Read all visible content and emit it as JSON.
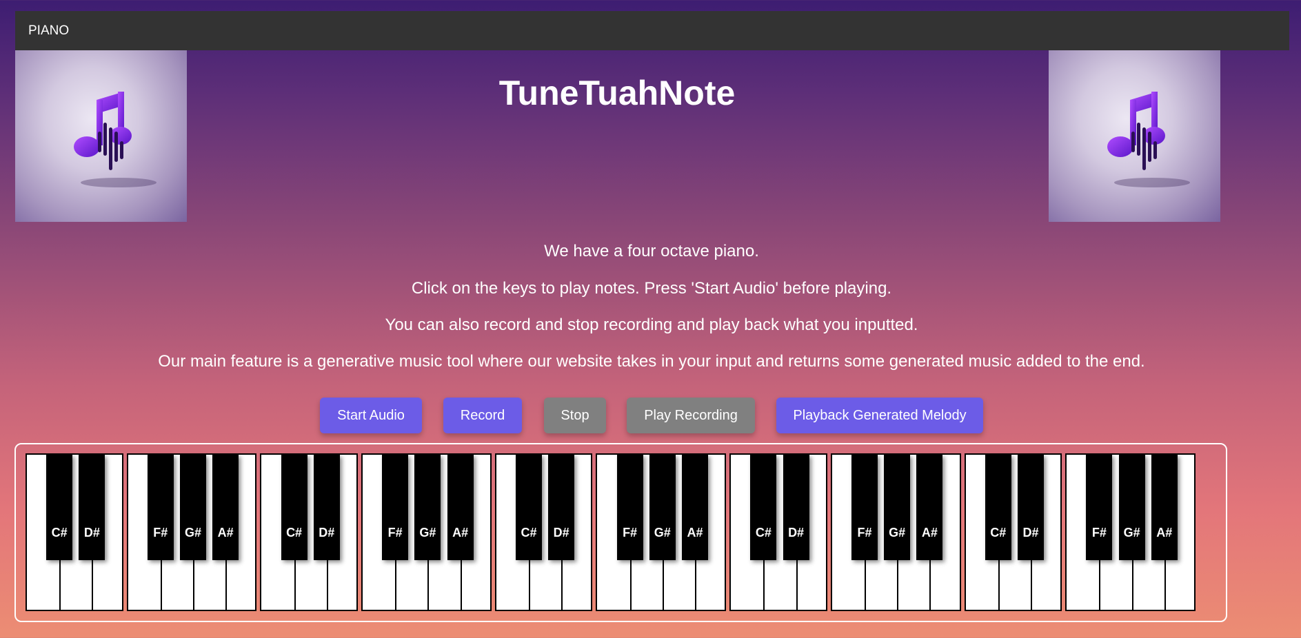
{
  "navbar": {
    "brand": "PIANO"
  },
  "header": {
    "title": "TuneTuahNote",
    "logo_icon": "music-note-icon"
  },
  "description": [
    "We have a four octave piano.",
    "Click on the keys to play notes. Press 'Start Audio' before playing.",
    "You can also record and stop recording and play back what you inputted.",
    "Our main feature is a generative music tool where our website takes in your input and returns some generated music added to the end."
  ],
  "controls": {
    "start_audio": "Start Audio",
    "record": "Record",
    "stop": "Stop",
    "play_recording": "Play Recording",
    "playback_generated": "Playback Generated Melody"
  },
  "colors": {
    "purple_button": "#6c5ce7",
    "gray_button": "#808080",
    "navbar": "#333333"
  },
  "piano": {
    "groups": [
      [
        "C#",
        "D#"
      ],
      [
        "F#",
        "G#",
        "A#"
      ],
      [
        "C#",
        "D#"
      ],
      [
        "F#",
        "G#",
        "A#"
      ],
      [
        "C#",
        "D#"
      ],
      [
        "F#",
        "G#",
        "A#"
      ],
      [
        "C#",
        "D#"
      ],
      [
        "F#",
        "G#",
        "A#"
      ],
      [
        "C#",
        "D#"
      ],
      [
        "F#",
        "G#",
        "A#"
      ]
    ]
  }
}
